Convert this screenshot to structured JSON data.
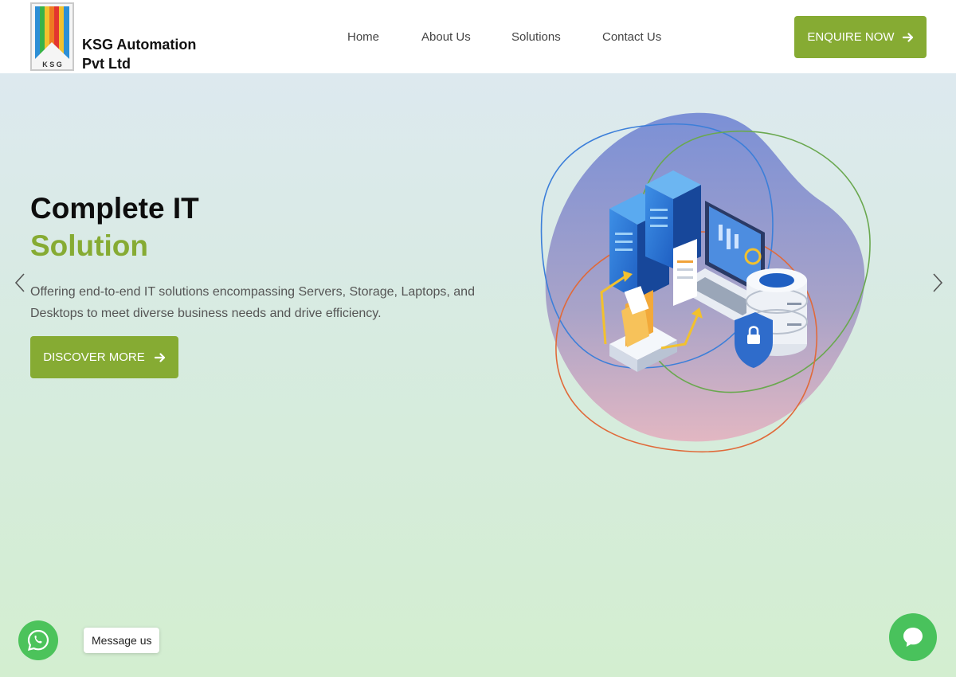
{
  "header": {
    "brand_line1": "KSG Automation",
    "brand_line2": "Pvt Ltd",
    "logo_letters": "K S G",
    "nav": [
      "Home",
      "About Us",
      "Solutions",
      "Contact Us"
    ],
    "enquire_label": "ENQUIRE NOW"
  },
  "hero": {
    "title": "Complete IT",
    "title_accent": "Solution",
    "description": "Offering end-to-end IT solutions encompassing Servers, Storage, Laptops, and Desktops to meet diverse business needs and drive efficiency.",
    "cta_label": "DISCOVER MORE",
    "illustration_icon": "it-infrastructure-illustration"
  },
  "widgets": {
    "message_label": "Message us",
    "whatsapp_icon": "whatsapp-icon",
    "chat_icon": "chat-bubble-icon"
  },
  "colors": {
    "accent": "#86ab33",
    "whatsapp": "#4cc35b",
    "chat": "#49c25c"
  }
}
